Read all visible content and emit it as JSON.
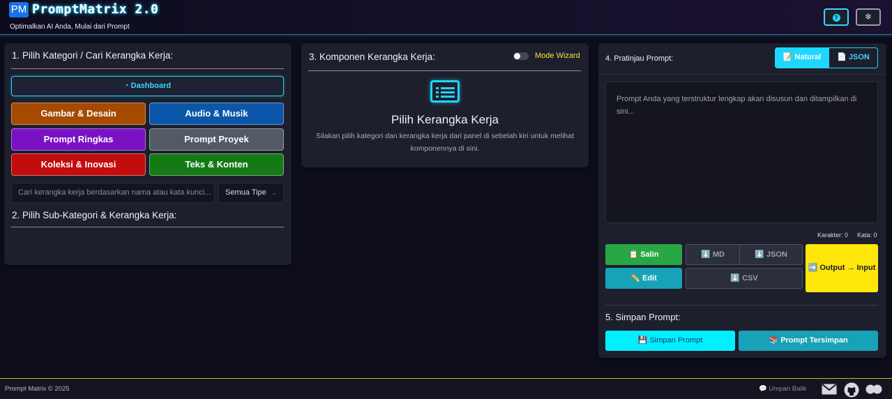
{
  "header": {
    "logo_badge": "PM",
    "title": "PromptMatrix 2.0",
    "subtitle": "Optimalkan AI Anda, Mulai dari Prompt",
    "help_label": "?",
    "settings_icon": "gear-icon",
    "help_icon": "question-circle-icon"
  },
  "panel1": {
    "title": "1. Pilih Kategori / Cari Kerangka Kerja:",
    "dashboard_label": "Dashboard",
    "dashboard_icon": "gauge-icon",
    "categories": [
      {
        "label": "Gambar & Desain",
        "color": "#a54a00"
      },
      {
        "label": "Audio & Musik",
        "color": "#0b56a8"
      },
      {
        "label": "Prompt Ringkas",
        "color": "#7a12c4"
      },
      {
        "label": "Prompt Proyek",
        "color": "#525a66"
      },
      {
        "label": "Koleksi & Inovasi",
        "color": "#c30c0c"
      },
      {
        "label": "Teks & Konten",
        "color": "#157a15"
      }
    ],
    "search_placeholder": "Cari kerangka kerja berdasarkan nama atau kata kunci...",
    "type_select": "Semua Tipe",
    "subtitle2": "2. Pilih Sub-Kategori & Kerangka Kerja:"
  },
  "panel3": {
    "title": "3. Komponen Kerangka Kerja:",
    "wizard_label": "Mode Wizard",
    "wizard_on": false,
    "empty_icon": "list-icon",
    "empty_title": "Pilih Kerangka Kerja",
    "empty_desc": "Silakan pilih kategori dan kerangka kerja dari panel di sebelah kiri untuk melihat komponennya di sini."
  },
  "panel4": {
    "title": "4. Pratinjau Prompt:",
    "tab_natural": "📝 Natural",
    "tab_json": "📄 JSON",
    "preview_placeholder": "Prompt Anda yang terstruktur lengkap akan disusun dan ditampilkan di sini...",
    "char_count": "Karakter: 0",
    "word_count": "Kata: 0",
    "copy_label": "📋 Salin",
    "edit_label": "✏️ Edit",
    "md_label": "⬇️ MD",
    "json_dl_label": "⬇️ JSON",
    "csv_label": "⬇️ CSV",
    "output_input_label": "➡️ Output → Input",
    "save_title": "5. Simpan Prompt:",
    "save_label": "💾 Simpan Prompt",
    "saved_label": "📚 Prompt Tersimpan"
  },
  "footer": {
    "copyright": "Prompt Matrix © 2025",
    "feedback": "💬 Umpan Balik",
    "icons": [
      "envelope-icon",
      "github-icon",
      "discord-icon"
    ]
  }
}
